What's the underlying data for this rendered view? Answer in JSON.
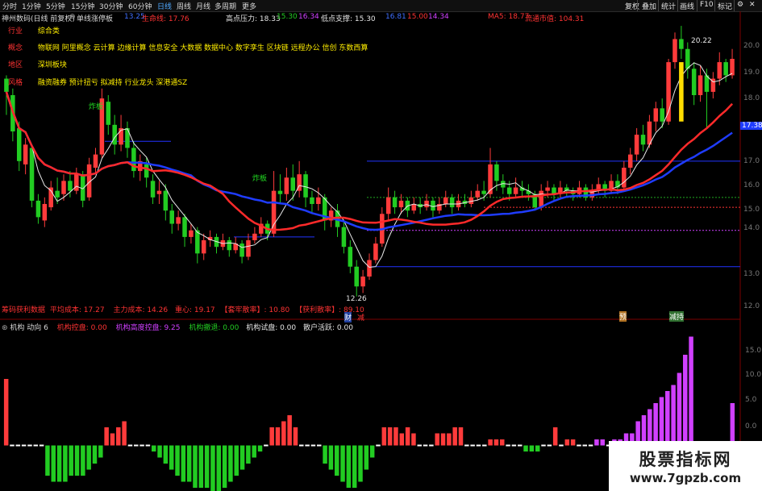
{
  "toolbar": {
    "periods": [
      "分时",
      "1分钟",
      "5分钟",
      "15分钟",
      "30分钟",
      "60分钟",
      "日线",
      "周线",
      "月线",
      "多周期",
      "更多"
    ],
    "selected_period": "日线",
    "right_buttons": [
      "复权",
      "叠加",
      "统计",
      "画线",
      "F10",
      "标记"
    ]
  },
  "info": {
    "stock": "神州数码(日线 前复权)",
    "indicator": "单线涨停板",
    "v1": "13.25",
    "lifeline_label": "生命线: 17.76",
    "resist_label": "高点压力: 18.33",
    "resist_v2": "15.30",
    "resist_v3": "16.34",
    "support_label": "低点支撑: 15.30",
    "support_v1": "16.81",
    "support_v2": "15.00",
    "support_v3": "14.34",
    "ma5_label": "MA5: 18.77",
    "float_cap_label": "流通市值: 104.31"
  },
  "tags": [
    {
      "key": "行业",
      "value": "综合类"
    },
    {
      "key": "概念",
      "value": "物联网 阿里概念 云计算 边缘计算 信息安全 大数据 数据中心 数字孪生 区块链 远程办公 信创 东数西算"
    },
    {
      "key": "地区",
      "value": "深圳板块"
    },
    {
      "key": "风格",
      "value": "融资融券 预计扭亏 拟减持 行业龙头 深港通SZ"
    }
  ],
  "chart_annotations": {
    "limit_up_1": "炸板",
    "limit_up_2": "炸板",
    "high_price": "20.22",
    "low_price": "12.26",
    "price_tag": "17.38",
    "cai": "财",
    "jian": "减",
    "yu": "预",
    "zeng": "减持"
  },
  "cost_line": {
    "prefix": "筹码获利数据",
    "avg_cost": "平均成本: 17.27",
    "main_cost": "主力成本: 14.26",
    "center": "重心: 19.17",
    "profit": "【套牢散率】: 10.80",
    "win": "【获利散率】: 89.10"
  },
  "lower_header": {
    "title": "机构 动向 6",
    "inst_control": "机构控盘: 0.00",
    "inst_high_control": "机构高度控盘: 9.25",
    "inst_retreat": "机构撤退: 0.00",
    "inst_test": "机构试盘: 0.00",
    "retail_active": "散户活跃: 0.00"
  },
  "price_axis": [
    "20.0",
    "19.0",
    "18.0",
    "17.0",
    "16.0",
    "15.0",
    "14.0",
    "13.0",
    "12.0"
  ],
  "lower_axis": [
    "15.0",
    "10.0",
    "5.0",
    "0.0"
  ],
  "colors": {
    "up": "#ff3b3b",
    "down": "#22cc22",
    "ma_white": "#e8e8e8",
    "ma_blue": "#1f3cff",
    "ma_red": "#ff2a2a",
    "purple": "#d040ff"
  },
  "chart_data": {
    "type": "candlestick",
    "price_ylim": [
      11.8,
      20.6
    ],
    "candles": [
      [
        18.9,
        18.5,
        19.0,
        17.8
      ],
      [
        18.4,
        17.3,
        18.6,
        17.0
      ],
      [
        17.4,
        16.4,
        17.6,
        16.1
      ],
      [
        16.3,
        16.9,
        17.1,
        16.0
      ],
      [
        16.8,
        15.2,
        16.9,
        15.0
      ],
      [
        15.2,
        14.7,
        15.4,
        14.5
      ],
      [
        14.6,
        15.1,
        15.3,
        14.4
      ],
      [
        15.0,
        15.6,
        15.8,
        14.9
      ],
      [
        15.5,
        15.3,
        15.9,
        15.1
      ],
      [
        15.4,
        15.8,
        16.0,
        15.2
      ],
      [
        15.8,
        15.5,
        16.1,
        15.3
      ],
      [
        15.5,
        16.0,
        16.2,
        15.4
      ],
      [
        16.0,
        15.2,
        16.1,
        15.0
      ],
      [
        15.3,
        16.3,
        16.5,
        15.2
      ],
      [
        16.2,
        16.6,
        16.8,
        16.0
      ],
      [
        16.6,
        18.3,
        18.6,
        16.5
      ],
      [
        18.2,
        17.5,
        18.4,
        17.2
      ],
      [
        17.5,
        16.9,
        17.8,
        16.6
      ],
      [
        16.9,
        17.4,
        17.8,
        16.7
      ],
      [
        17.4,
        16.8,
        17.6,
        16.5
      ],
      [
        16.8,
        16.1,
        17.0,
        15.9
      ],
      [
        16.1,
        16.4,
        16.6,
        15.8
      ],
      [
        16.3,
        15.9,
        16.5,
        15.6
      ],
      [
        15.8,
        15.3,
        16.0,
        15.1
      ],
      [
        15.4,
        15.5,
        15.8,
        15.1
      ],
      [
        15.5,
        14.9,
        15.7,
        14.6
      ],
      [
        14.9,
        14.5,
        15.1,
        14.2
      ],
      [
        14.5,
        14.7,
        14.9,
        14.3
      ],
      [
        14.7,
        14.1,
        14.8,
        13.8
      ],
      [
        14.1,
        14.3,
        14.5,
        13.9
      ],
      [
        14.3,
        13.6,
        14.4,
        13.3
      ],
      [
        13.6,
        14.0,
        14.2,
        13.4
      ],
      [
        14.0,
        14.1,
        14.3,
        13.8
      ],
      [
        14.1,
        13.8,
        14.2,
        13.6
      ],
      [
        13.8,
        14.0,
        14.2,
        13.7
      ],
      [
        14.0,
        13.7,
        14.1,
        13.5
      ],
      [
        13.7,
        13.9,
        14.1,
        13.6
      ],
      [
        13.9,
        13.5,
        14.0,
        13.3
      ],
      [
        13.5,
        14.0,
        14.2,
        13.4
      ],
      [
        14.0,
        14.2,
        14.4,
        13.9
      ],
      [
        14.2,
        14.5,
        14.7,
        14.1
      ],
      [
        14.5,
        14.2,
        14.6,
        14.0
      ],
      [
        14.2,
        15.5,
        16.1,
        14.1
      ],
      [
        15.5,
        15.4,
        16.0,
        15.1
      ],
      [
        15.4,
        15.9,
        16.2,
        15.2
      ],
      [
        15.9,
        15.5,
        16.3,
        15.2
      ],
      [
        15.5,
        16.0,
        16.4,
        15.3
      ],
      [
        16.0,
        15.3,
        16.1,
        15.0
      ],
      [
        15.3,
        15.1,
        15.5,
        14.8
      ],
      [
        15.1,
        15.3,
        15.6,
        14.9
      ],
      [
        15.3,
        14.6,
        15.4,
        14.3
      ],
      [
        14.6,
        14.9,
        15.0,
        14.4
      ],
      [
        14.9,
        14.4,
        15.1,
        14.1
      ],
      [
        14.4,
        13.8,
        14.6,
        13.6
      ],
      [
        13.8,
        13.2,
        14.0,
        13.0
      ],
      [
        13.2,
        12.6,
        13.4,
        12.3
      ],
      [
        12.6,
        12.9,
        13.1,
        12.4
      ],
      [
        12.9,
        13.4,
        13.6,
        12.8
      ],
      [
        13.4,
        13.9,
        14.1,
        13.3
      ],
      [
        13.9,
        14.8,
        15.0,
        13.8
      ],
      [
        14.8,
        15.3,
        15.6,
        14.6
      ],
      [
        15.3,
        15.0,
        15.5,
        14.8
      ],
      [
        15.0,
        15.2,
        15.4,
        14.8
      ],
      [
        15.2,
        14.9,
        15.3,
        14.7
      ],
      [
        14.9,
        15.1,
        15.3,
        14.8
      ],
      [
        15.1,
        15.0,
        15.3,
        14.8
      ],
      [
        15.0,
        15.2,
        15.4,
        14.9
      ],
      [
        15.2,
        14.9,
        15.3,
        14.7
      ],
      [
        14.9,
        15.1,
        15.3,
        14.8
      ],
      [
        15.1,
        15.3,
        15.5,
        15.0
      ],
      [
        15.3,
        15.0,
        15.4,
        14.8
      ],
      [
        15.0,
        15.2,
        15.4,
        14.9
      ],
      [
        15.2,
        15.1,
        15.4,
        15.0
      ],
      [
        15.1,
        15.3,
        15.5,
        15.0
      ],
      [
        15.3,
        15.5,
        15.7,
        15.2
      ],
      [
        15.5,
        15.4,
        15.8,
        15.2
      ],
      [
        15.4,
        16.3,
        16.8,
        15.3
      ],
      [
        16.3,
        15.8,
        16.4,
        15.5
      ],
      [
        15.8,
        15.6,
        16.0,
        15.4
      ],
      [
        15.6,
        15.4,
        15.8,
        15.2
      ],
      [
        15.4,
        15.6,
        15.9,
        15.3
      ],
      [
        15.6,
        15.5,
        15.8,
        15.3
      ],
      [
        15.5,
        15.4,
        15.7,
        15.2
      ],
      [
        15.4,
        15.0,
        15.5,
        14.9
      ],
      [
        15.0,
        15.5,
        15.7,
        14.9
      ],
      [
        15.5,
        15.6,
        15.8,
        15.3
      ],
      [
        15.6,
        15.4,
        15.7,
        15.2
      ],
      [
        15.4,
        15.6,
        15.8,
        15.3
      ],
      [
        15.6,
        15.5,
        15.7,
        15.3
      ],
      [
        15.5,
        15.4,
        15.6,
        15.2
      ],
      [
        15.4,
        15.6,
        15.8,
        15.3
      ],
      [
        15.6,
        15.3,
        15.7,
        15.2
      ],
      [
        15.3,
        15.5,
        15.7,
        15.2
      ],
      [
        15.5,
        15.7,
        15.9,
        15.4
      ],
      [
        15.7,
        15.5,
        15.8,
        15.3
      ],
      [
        15.5,
        15.8,
        16.0,
        15.4
      ],
      [
        15.8,
        15.6,
        16.0,
        15.4
      ],
      [
        15.6,
        16.2,
        16.4,
        15.5
      ],
      [
        16.2,
        16.6,
        16.8,
        16.0
      ],
      [
        16.6,
        17.2,
        17.4,
        16.4
      ],
      [
        17.2,
        16.9,
        17.5,
        16.7
      ],
      [
        16.9,
        17.6,
        17.8,
        16.8
      ],
      [
        17.6,
        18.0,
        18.2,
        17.3
      ],
      [
        18.0,
        17.6,
        18.3,
        17.4
      ],
      [
        17.6,
        19.4,
        19.5,
        17.5
      ],
      [
        19.4,
        20.1,
        20.3,
        19.2
      ],
      [
        20.1,
        19.8,
        20.5,
        19.5
      ],
      [
        19.8,
        19.2,
        20.0,
        18.9
      ],
      [
        19.2,
        18.4,
        19.4,
        18.1
      ],
      [
        18.4,
        19.0,
        19.3,
        18.2
      ],
      [
        19.0,
        18.5,
        19.2,
        17.4
      ],
      [
        18.5,
        18.9,
        19.1,
        18.3
      ],
      [
        18.9,
        19.4,
        19.7,
        18.7
      ],
      [
        19.4,
        19.0,
        19.5,
        18.8
      ],
      [
        19.0,
        19.5,
        19.8,
        18.9
      ]
    ],
    "lower_values": [
      11,
      0,
      0,
      0,
      0,
      0,
      0,
      -5,
      -6,
      -6,
      -6,
      -5,
      -5,
      -5,
      -4,
      -3,
      -2,
      3,
      2,
      3,
      4,
      0,
      0,
      0,
      0,
      -1,
      -2,
      -3,
      -4,
      -5,
      -6,
      -6,
      -7,
      -7,
      -7,
      -8,
      -8,
      -7,
      -6,
      -5,
      -4,
      -3,
      -2,
      -1,
      0,
      3,
      3,
      4,
      5,
      3,
      0,
      0,
      0,
      0,
      -3,
      -4,
      -5,
      -6,
      -7,
      -7,
      -6,
      -4,
      -2,
      0,
      3,
      3,
      3,
      2,
      3,
      2,
      0,
      0,
      0,
      2,
      2,
      2,
      3,
      3,
      0,
      0,
      0,
      0,
      1,
      1,
      1,
      0,
      0,
      0,
      -1,
      -1,
      -1,
      0,
      0,
      3,
      0,
      1,
      1,
      0,
      0,
      0,
      1,
      1,
      0,
      1,
      1,
      2,
      2,
      4,
      5,
      6,
      7,
      8,
      9,
      10,
      12,
      15,
      18,
      0,
      0,
      0,
      0,
      0,
      0,
      7
    ],
    "lower_ylim": [
      -7,
      19
    ]
  }
}
